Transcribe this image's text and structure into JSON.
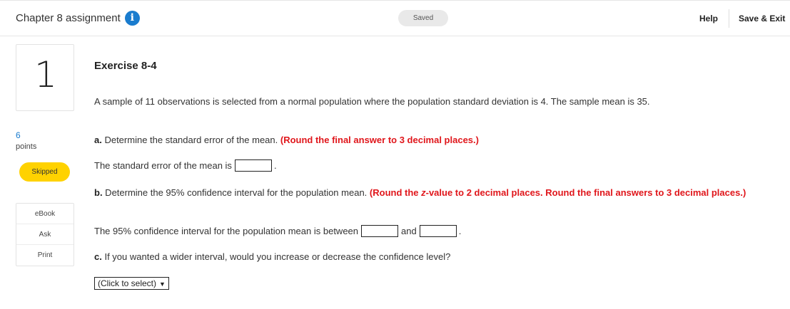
{
  "header": {
    "assignment_title": "Chapter 8 assignment",
    "info_icon": "info-icon",
    "info_glyph": "i",
    "saved_label": "Saved",
    "help_label": "Help",
    "save_exit_label": "Save & Exit"
  },
  "question": {
    "number": "1",
    "points_value": "6",
    "points_label": "points",
    "status_label": "Skipped"
  },
  "tools": [
    {
      "label": "eBook"
    },
    {
      "label": "Ask"
    },
    {
      "label": "Print"
    }
  ],
  "exercise": {
    "title": "Exercise 8-4",
    "problem": "A sample of 11 observations is selected from a normal population where the population standard deviation is 4. The sample mean is 35.",
    "part_a": {
      "label": "a.",
      "text": " Determine the standard error of the mean. ",
      "instruction": "(Round the final answer to 3 decimal places.)",
      "answer_prefix": "The standard error of the mean is",
      "answer_value": "",
      "answer_suffix": "."
    },
    "part_b": {
      "label": "b.",
      "text": " Determine the 95% confidence interval for the population mean. ",
      "instruction_1": "(Round the ",
      "instruction_z": "z",
      "instruction_2": "-value to 2 decimal places. Round the final answers to 3 decimal places.)",
      "answer_prefix": "The 95% confidence interval for the population mean is between",
      "answer_lower": "",
      "and_label": "and",
      "answer_upper": "",
      "answer_suffix": "."
    },
    "part_c": {
      "label": "c.",
      "text": " If you wanted a wider interval, would you increase or decrease the confidence level?",
      "select_value": "(Click to select)",
      "select_caret": "▼"
    }
  },
  "colors": {
    "accent_blue": "#1a7cce",
    "skipped_yellow": "#ffd200",
    "instruction_red": "#e0161b"
  }
}
